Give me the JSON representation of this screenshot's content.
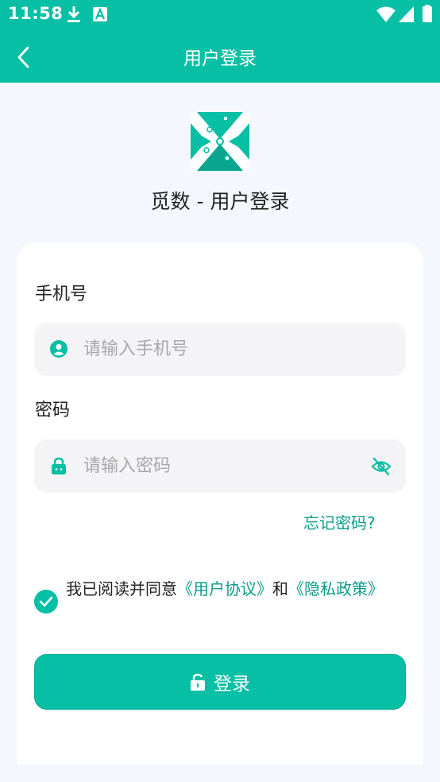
{
  "status_bar": {
    "time": "11:58",
    "icons": [
      "download-icon",
      "font-icon",
      "wifi-icon",
      "signal-icon",
      "battery-icon"
    ]
  },
  "nav": {
    "back_icon": "chevron-left-icon",
    "title": "用户登录"
  },
  "app": {
    "title": "觅数 - 用户登录"
  },
  "form": {
    "phone_label": "手机号",
    "phone_placeholder": "请输入手机号",
    "phone_value": "",
    "password_label": "密码",
    "password_placeholder": "请输入密码",
    "password_value": "",
    "forgot_password": "忘记密码?"
  },
  "agreement": {
    "checked": true,
    "prefix": "我已阅读并同意",
    "user_agreement": "《用户协议》",
    "and": "和",
    "privacy_policy": "《隐私政策》"
  },
  "login_button": {
    "label": "登录",
    "icon": "unlock-icon"
  },
  "colors": {
    "brand": "#06bfa4",
    "link": "#0a9c8a",
    "background": "#f4f8fe"
  }
}
